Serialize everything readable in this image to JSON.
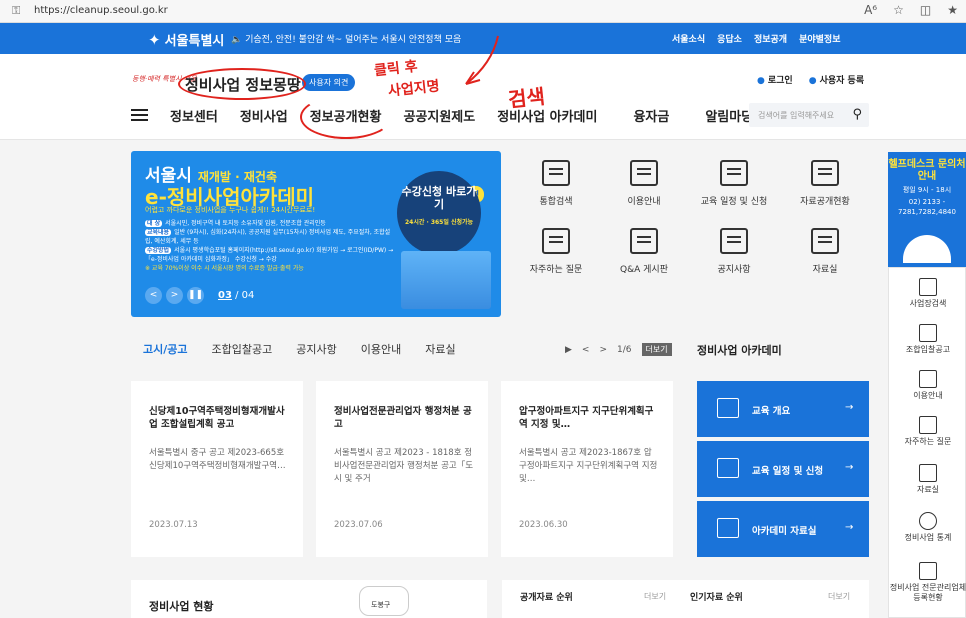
{
  "browser": {
    "url": "https://cleanup.seoul.go.kr"
  },
  "topbar": {
    "logo": "서울특별시",
    "notice": "기승전, 안전! 불안감 싹~ 덜어주는 서울시 안전정책 모음",
    "links": [
      "서울소식",
      "응답소",
      "정보공개",
      "분야별정보"
    ]
  },
  "header": {
    "brand_mini": "동행·매력 특별시 서울",
    "site_title": "정비사업 정보몽땅",
    "opinion_button": "사용자 의견",
    "login": "로그인",
    "register": "사용자 등록",
    "gnb": [
      "정보센터",
      "정비사업",
      "정보공개현황",
      "공공지원제도",
      "정비사업 아카데미",
      "융자금",
      "알림마당"
    ],
    "search_placeholder": "검색어를 입력해주세요"
  },
  "annotations": {
    "note1": "클릭 후",
    "note2": "사업지명",
    "note3": "검색"
  },
  "banner": {
    "title": "서울시",
    "title_sub": "재개발 · 재건축",
    "headline": "e-정비사업아카데미",
    "badge": "상시운영",
    "subtitle": "어렵고 까다로운 정비사업을 누구나 쉽게!! 24시간무료로!",
    "rows": [
      {
        "tag": "대 상",
        "text": "서울시민, 정비구역 내 토지등 소유자및 임원, 전문조합 관리인등"
      },
      {
        "tag": "교육내용",
        "text": "일반 (9차시), 심화(24차시), 공공지원 실무(15차시) 정비사업 제도, 주요절차, 조합설립, 예산회계, 세무 등"
      },
      {
        "tag": "수강방법",
        "text": "서울시 평생학습포털 홈페이지(http://sll.seoul.go.kr) 회원가입 → 로그인(ID/PW) → 「e-정비사업 아카데미 심화과정」 수강신청 → 수강"
      },
      {
        "tag": "",
        "text": "※ 교육 70%이상 이수 시 서울시장 명의 수료증 발급·출력 가능"
      }
    ],
    "circle_main": "수강신청 바로가기",
    "circle_sub": "24시간 · 365일 신청가능",
    "page_current": "03",
    "page_total": "04"
  },
  "quick": [
    "통합검색",
    "이용안내",
    "교육 일정 및 신청",
    "자료공개현황",
    "자주하는 질문",
    "Q&A 게시판",
    "공지사항",
    "자료실"
  ],
  "helpdesk": {
    "title": "헬프데스크 문의처안내",
    "hours": "평일 9시 - 18시",
    "phone": "02) 2133 - 7281,7282,4840"
  },
  "sidemenu": [
    "사업장검색",
    "조합입찰공고",
    "이용안내",
    "자주하는 질문",
    "자료실",
    "정비사업 통계",
    "정비사업 전문관리업체 등록현황"
  ],
  "tabs": [
    "고시/공고",
    "조합입찰공고",
    "공지사항",
    "이용안내",
    "자료실"
  ],
  "pager": {
    "page": "1/6",
    "more": "더보기"
  },
  "cards": [
    {
      "title": "신당제10구역주택정비형재개발사업 조합설립계획 공고",
      "body": "서울특별시 중구 공고 제2023-665호 신당제10구역주택정비형재개발구역…",
      "date": "2023.07.13"
    },
    {
      "title": "정비사업전문관리업자 행정처분 공고",
      "body": "서울특별시 공고 제2023 - 1818호 정비사업전문관리업자 행정처분 공고「도시 및 주거",
      "date": "2023.07.06"
    },
    {
      "title": "압구정아파트지구 지구단위계획구역 지정 및…",
      "body": "서울특별시 공고 제2023-1867호 압구정아파트지구 지구단위계획구역 지정 및…",
      "date": "2023.06.30"
    }
  ],
  "academy": {
    "title": "정비사업 아카데미",
    "items": [
      "교육 개요",
      "교육 일정 및 신청",
      "아카데미 자료실"
    ]
  },
  "bottom": {
    "status_title": "정비사업 현황",
    "map_label": "도봉구",
    "rank1": "공개자료 순위",
    "rank2": "인기자료 순위",
    "more": "더보기"
  }
}
